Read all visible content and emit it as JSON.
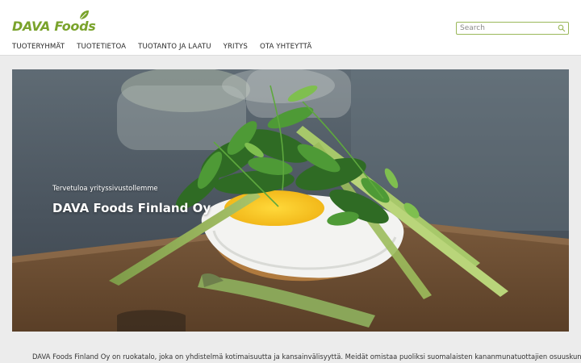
{
  "brand": {
    "logo_text": "DAVA Foods",
    "logo_icon": "leaf-icon",
    "accent_color": "#7aa32c"
  },
  "search": {
    "placeholder": "Search",
    "icon": "search-icon"
  },
  "nav": {
    "items": [
      {
        "label": "TUOTERYHMÄT"
      },
      {
        "label": "TUOTETIETOA"
      },
      {
        "label": "TUOTANTO JA LAATU"
      },
      {
        "label": "YRITYS"
      },
      {
        "label": "OTA YHTEYTTÄ"
      }
    ]
  },
  "hero": {
    "subtitle": "Tervetuloa yrityssivustollemme",
    "title": "DAVA Foods Finland Oy"
  },
  "intro": {
    "text": "DAVA Foods Finland Oy on ruokatalo, joka on yhdistelmä kotimaisuutta ja kansainvälisyyttä. Meidät omistaa puoliksi suomalaisten kananmunatuottajien osuuskunta"
  }
}
